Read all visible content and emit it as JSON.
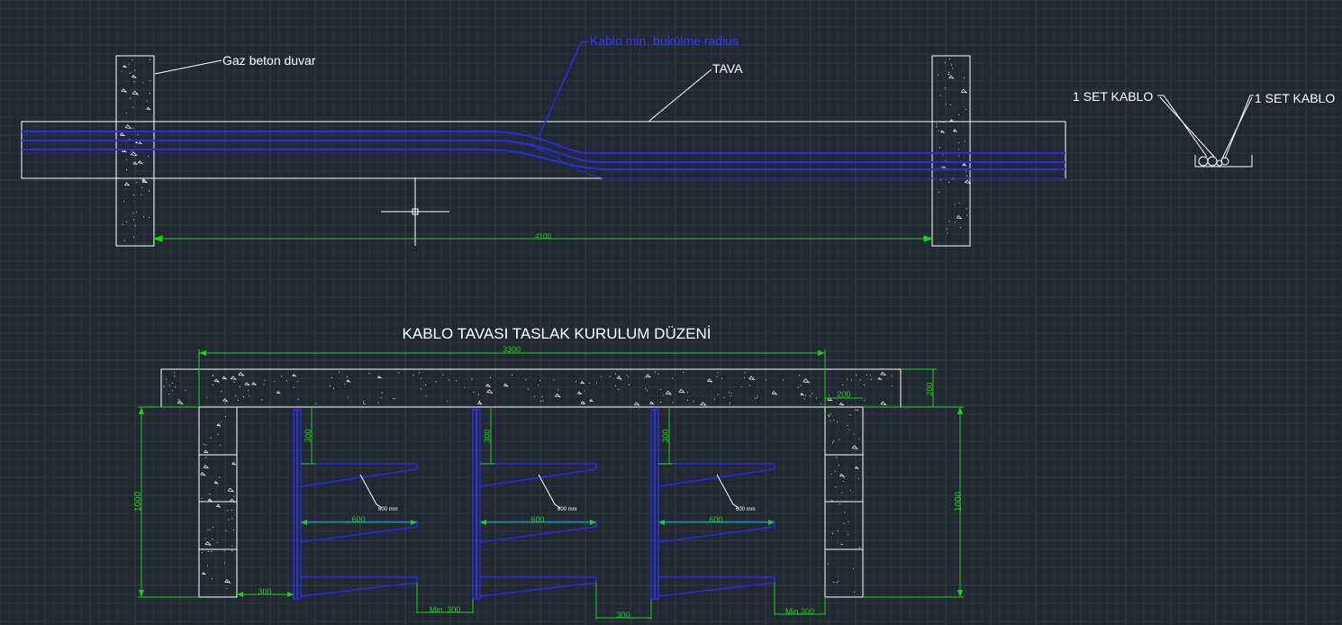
{
  "colors": {
    "background": "#212830",
    "grid_minor": "#2a323c",
    "grid_major": "#323b47",
    "outline": "#ffffff",
    "cable": "#2a2af0",
    "dimension": "#1fd11f",
    "cable_label": "#3b3bff"
  },
  "top_view": {
    "wall_label": "Gaz beton duvar",
    "bend_label": "Kablo min. bükülme radius",
    "tray_label": "TAVA",
    "span_dim": "4100"
  },
  "cross_section": {
    "left_label": "1 SET KABLO",
    "right_label": "1 SET KABLO"
  },
  "install_view": {
    "title": "KABLO TAVASI TASLAK KURULUM DÜZENİ",
    "top_dim": "3300",
    "slab_dim": "200",
    "wall_width_dim": "200",
    "left_height_dim": "1000",
    "right_height_dim": "1000",
    "bracket_gap_dims": [
      "300",
      "300",
      "300"
    ],
    "tray_width_dims": [
      "600",
      "600",
      "600"
    ],
    "tray_callouts": [
      "600 mm",
      "600 mm",
      "600 mm"
    ],
    "left_wall_gap_dim": "300",
    "floor_dims": [
      "Min. 300",
      "300",
      "Min.300"
    ]
  }
}
